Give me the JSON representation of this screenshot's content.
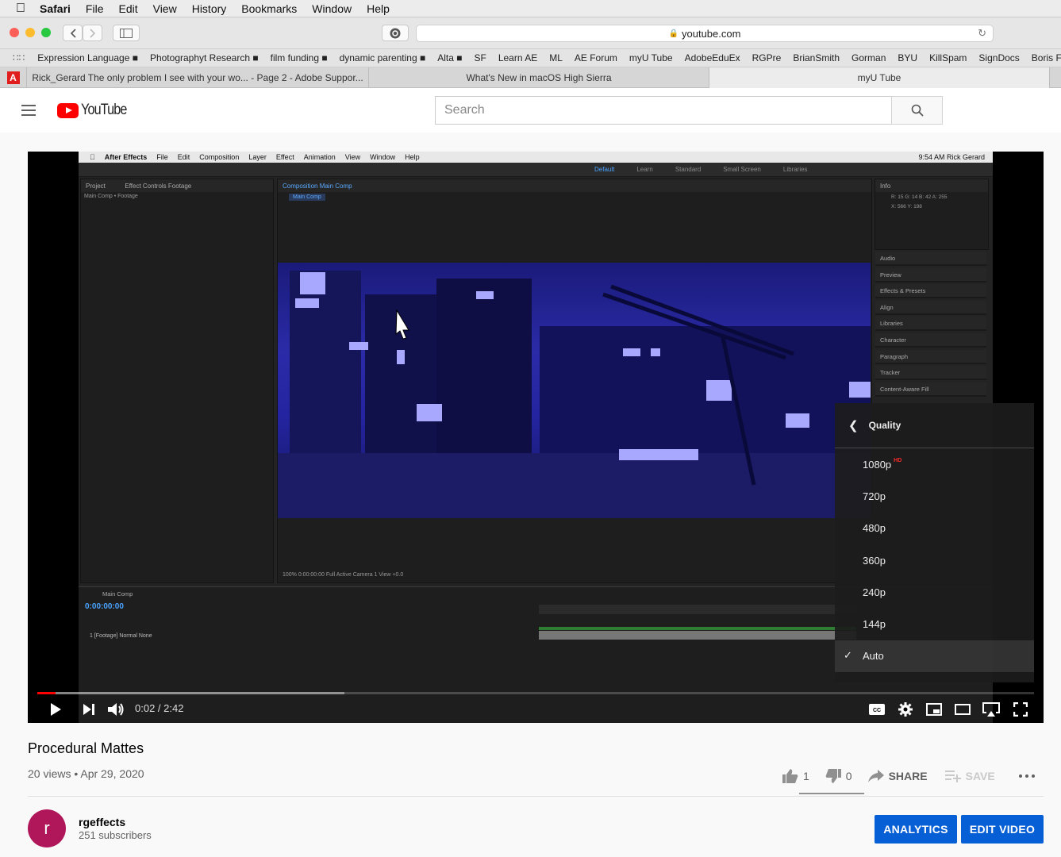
{
  "menubar": {
    "app": "Safari",
    "items": [
      "File",
      "Edit",
      "View",
      "History",
      "Bookmarks",
      "Window",
      "Help"
    ]
  },
  "address": {
    "url": "youtube.com"
  },
  "favorites": [
    "Expression Language ■",
    "Photographyt Research ■",
    "film funding ■",
    "dynamic parenting ■",
    "Alta ■",
    "SF",
    "Learn AE",
    "ML",
    "AE Forum",
    "myU Tube",
    "AdobeEduEx",
    "RGPre",
    "BrianSmith",
    "Gorman",
    "BYU",
    "KillSpam",
    "SignDocs",
    "Boris FX b"
  ],
  "tabs": [
    "Rick_Gerard The only problem I see with your wo... - Page 2 - Adobe Suppor...",
    "What's New in macOS High Sierra",
    "myU Tube"
  ],
  "youtube": {
    "logo_text": "YouTube",
    "search_placeholder": "Search"
  },
  "ae_screen": {
    "menu": [
      "After Effects",
      "File",
      "Edit",
      "Composition",
      "Layer",
      "Effect",
      "Animation",
      "View",
      "Window",
      "Help"
    ],
    "status_right": "9:54 AM   Rick Gerard",
    "workspaces": [
      "Default",
      "Learn",
      "Standard",
      "Small Screen",
      "Libraries"
    ],
    "project_tab": "Project",
    "effect_controls_tab": "Effect Controls Footage",
    "project_sub": "Main Comp • Footage",
    "composition_tab": "Composition Main Comp",
    "comp_label": "Main Comp",
    "info_tab": "Info",
    "info_values": "R: 15   G: 14   B: 42   A: 255",
    "info_xy": "X: 566  Y: 198",
    "panels": [
      "Audio",
      "Preview",
      "Effects & Presets",
      "Align",
      "Libraries",
      "Character",
      "Paragraph",
      "Tracker",
      "Content-Aware Fill"
    ],
    "comp_footer": "100%   0:00:00:00   Full   Active Camera   1 View   +0.0",
    "timeline_tab": "Main Comp",
    "timecode": "0:00:00:00",
    "layer_row": "1   [Footage]   Normal   None"
  },
  "quality_menu": {
    "title": "Quality",
    "options": [
      "1080p",
      "720p",
      "480p",
      "360p",
      "240p",
      "144p",
      "Auto"
    ],
    "hd_badge": "HD",
    "selected": "Auto"
  },
  "player": {
    "time": "0:02 / 2:42",
    "played_fraction": 0.018,
    "loaded_fraction": 0.308
  },
  "video": {
    "title": "Procedural Mattes",
    "meta": "20 views • Apr 29, 2020",
    "likes": "1",
    "dislikes": "0",
    "share_label": "SHARE",
    "save_label": "SAVE"
  },
  "channel": {
    "initial": "r",
    "name": "rgeffects",
    "subscribers": "251 subscribers"
  },
  "buttons": {
    "analytics": "ANALYTICS",
    "edit_video": "EDIT VIDEO"
  },
  "colors": {
    "youtube_red": "#ff0000",
    "button_blue": "#065fd4",
    "avatar": "#b0175a"
  }
}
